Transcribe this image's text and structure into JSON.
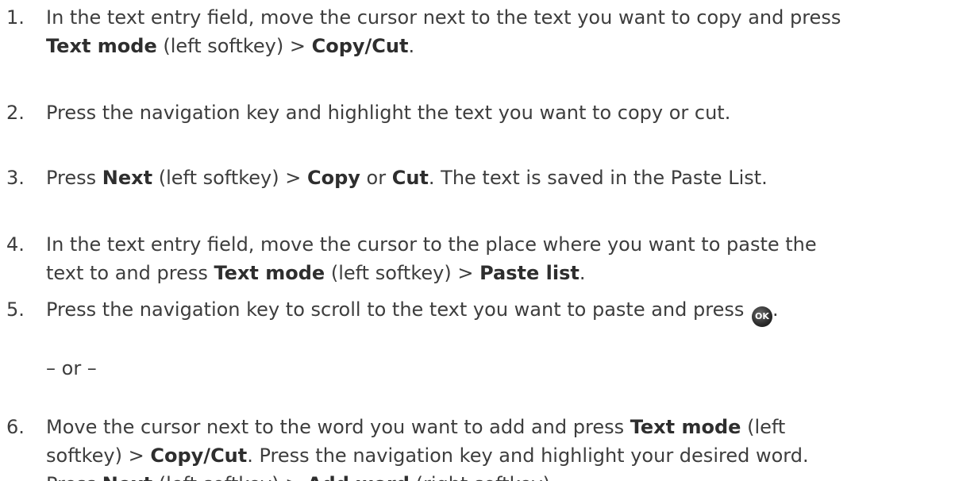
{
  "steps": [
    {
      "num": "1.",
      "line1": [
        {
          "t": "In the text entry field, move the cursor next to the text you want to copy and press",
          "b": false
        }
      ],
      "line2": [
        {
          "t": "Text mode",
          "b": true
        },
        {
          "t": " (left softkey) > ",
          "b": false
        },
        {
          "t": "Copy/Cut",
          "b": true
        },
        {
          "t": ".",
          "b": false
        }
      ]
    },
    {
      "num": "2.",
      "line1": [
        {
          "t": "Press the navigation key and highlight the text you want to copy or cut.",
          "b": false
        }
      ]
    },
    {
      "num": "3.",
      "line1": [
        {
          "t": "Press ",
          "b": false
        },
        {
          "t": "Next",
          "b": true
        },
        {
          "t": " (left softkey) > ",
          "b": false
        },
        {
          "t": "Copy",
          "b": true
        },
        {
          "t": " or ",
          "b": false
        },
        {
          "t": "Cut",
          "b": true
        },
        {
          "t": ". The text is saved in the Paste List.",
          "b": false
        }
      ]
    },
    {
      "num": "4.",
      "line1": [
        {
          "t": "In the text entry field, move the cursor to the place where you want to paste the",
          "b": false
        }
      ],
      "line2": [
        {
          "t": "text to and press ",
          "b": false
        },
        {
          "t": "Text mode",
          "b": true
        },
        {
          "t": " (left softkey) > ",
          "b": false
        },
        {
          "t": "Paste list",
          "b": true
        },
        {
          "t": ".",
          "b": false
        }
      ]
    },
    {
      "num": "5.",
      "line1": [
        {
          "t": "Press the navigation key to scroll to the text you want to paste and press ",
          "b": false
        }
      ],
      "ok_icon_label": "OK",
      "line1_after": "."
    },
    {
      "num": "6.",
      "line1": [
        {
          "t": "Move the cursor next to the word you want to add and press ",
          "b": false
        },
        {
          "t": "Text mode",
          "b": true
        },
        {
          "t": " (left",
          "b": false
        }
      ],
      "line2": [
        {
          "t": "softkey) > ",
          "b": false
        },
        {
          "t": "Copy/Cut",
          "b": true
        },
        {
          "t": ". Press the navigation key and highlight your desired word.",
          "b": false
        }
      ],
      "line3": [
        {
          "t": "Press ",
          "b": false
        },
        {
          "t": "Next",
          "b": true
        },
        {
          "t": " (left softkey) > ",
          "b": false
        },
        {
          "t": "Add word",
          "b": true
        },
        {
          "t": " (right softkey).",
          "b": false
        }
      ]
    }
  ],
  "or_text": "– or –",
  "icons": {
    "ok": "ok-button-icon"
  }
}
